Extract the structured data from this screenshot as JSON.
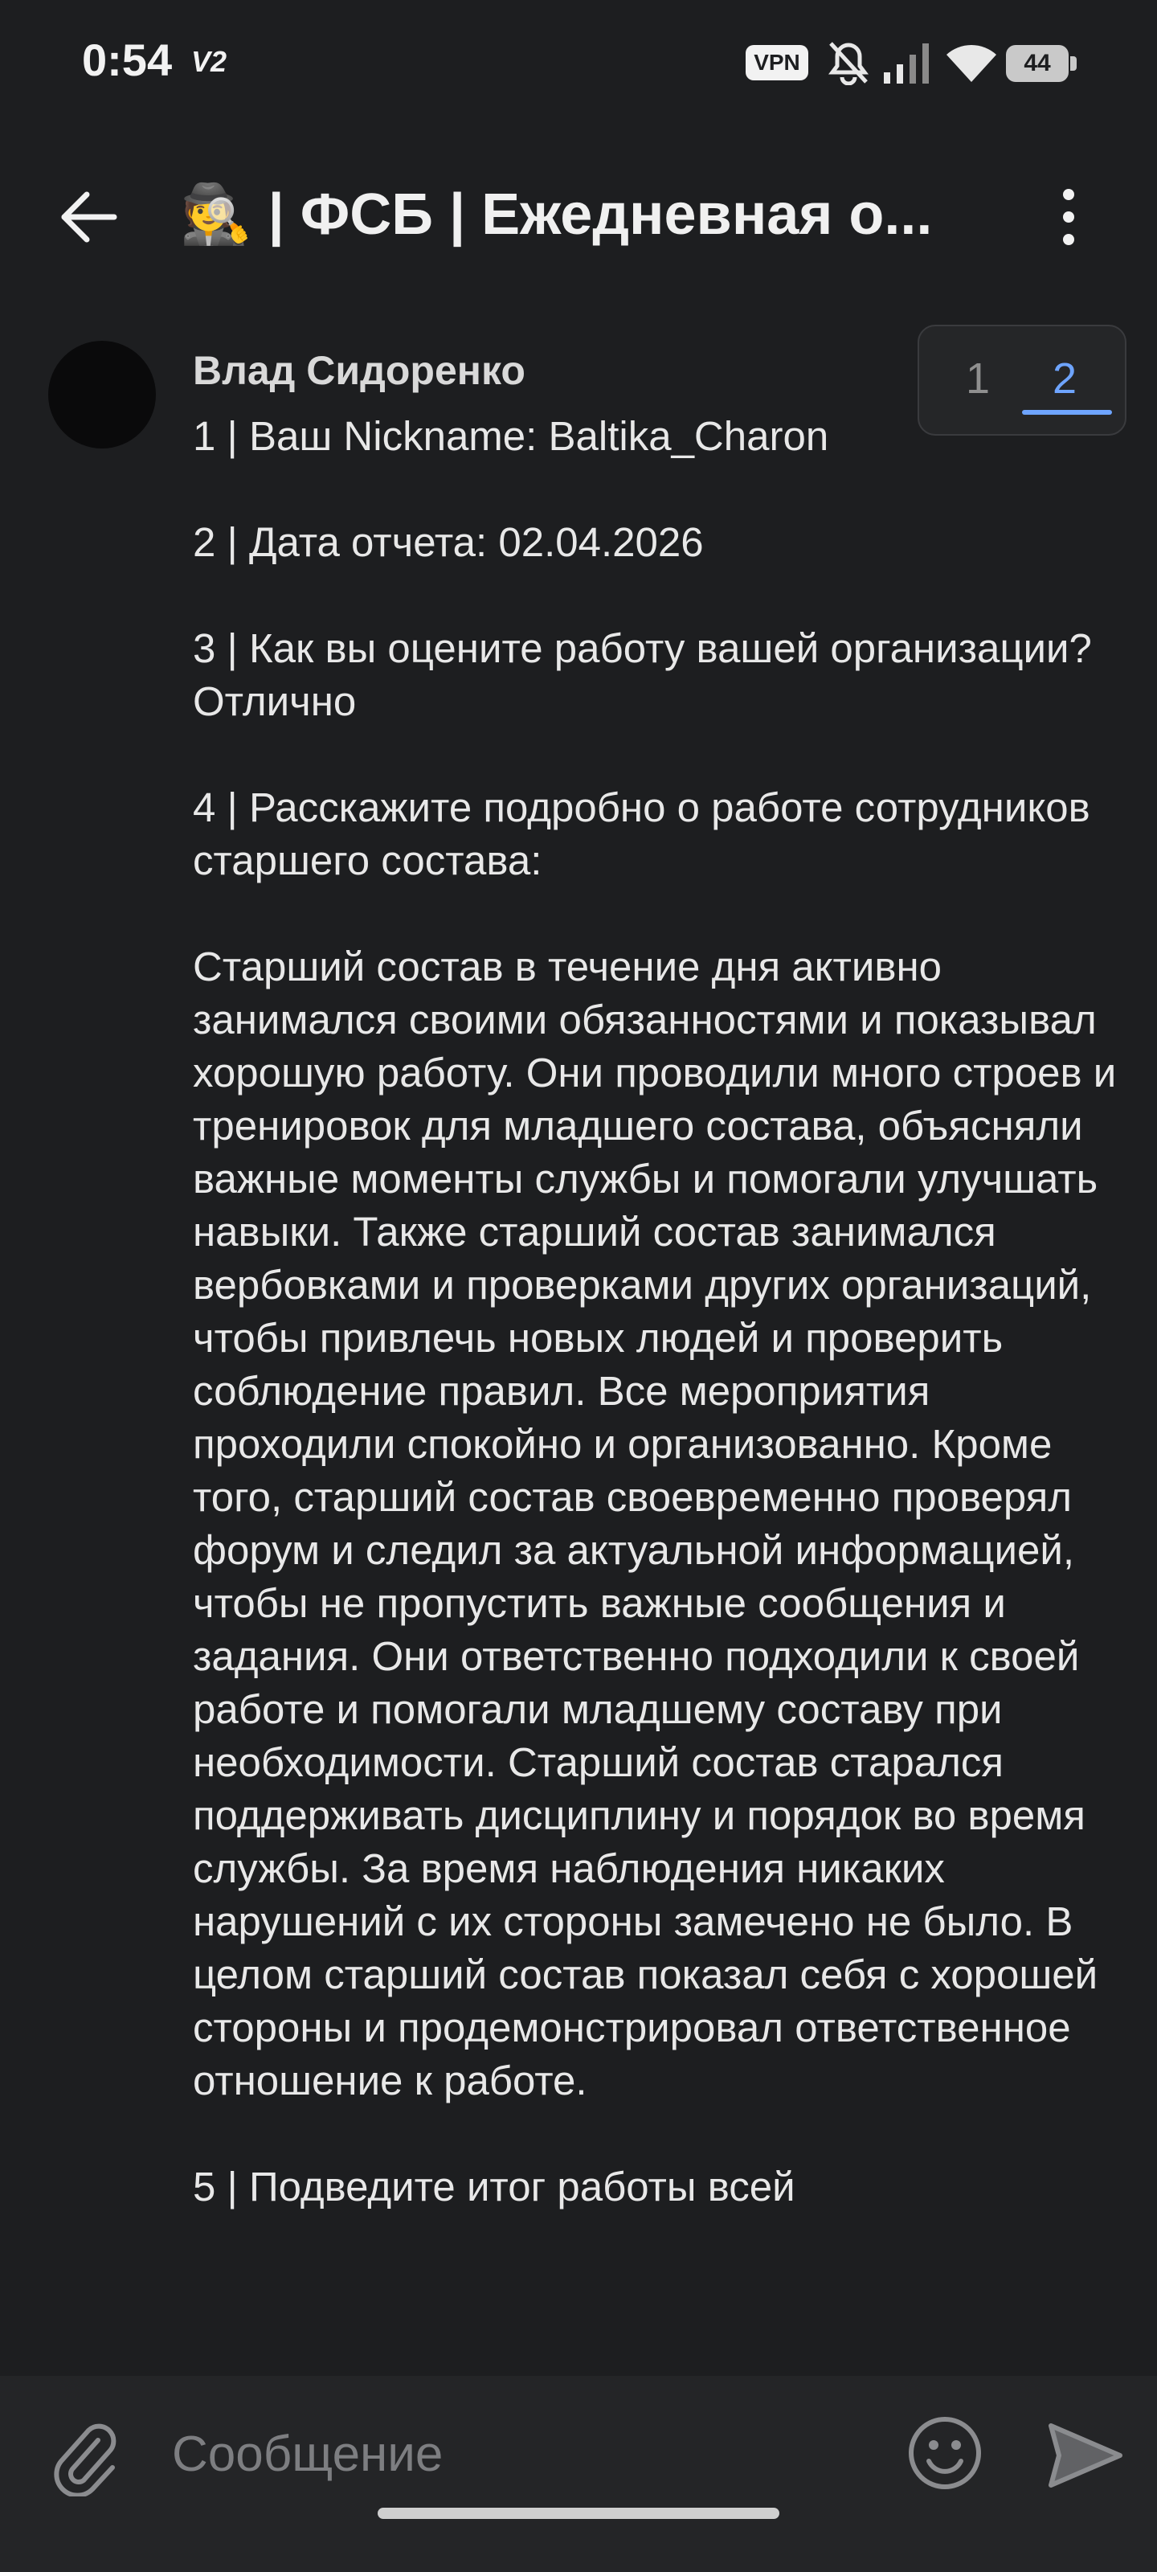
{
  "status_bar": {
    "time": "0:54",
    "network_label": "V2",
    "vpn_label": "VPN",
    "battery": "44",
    "icons": [
      "mute-icon",
      "signal-icon",
      "wifi-icon"
    ]
  },
  "header": {
    "title": "🕵️ | ФСБ | Ежедневная о...",
    "back_icon": "arrow-left-icon",
    "menu_icon": "more-vert-icon"
  },
  "message": {
    "author": "Влад Сидоренко",
    "paragraphs": [
      "1 | Ваш Nickname: Baltika_Charon",
      "2 | Дата отчета: 02.04.2026",
      "3 | Как вы оцените работу вашей организации? Отлично",
      "4 | Расскажите подробно о работе сотрудников старшего состава:",
      "Старший состав в течение дня активно занимался своими обязанностями и показывал хорошую работу. Они проводили много строев и тренировок для младшего состава, объясняли важные моменты службы и помогали улучшать навыки. Также старший состав занимался вербовками и проверками других организаций, чтобы привлечь новых людей и проверить соблюдение правил. Все мероприятия проходили спокойно и организованно. Кроме того, старший состав своевременно проверял форум и следил за актуальной информацией, чтобы не пропустить важные сообщения и задания. Они ответственно подходили к своей работе и помогали младшему составу при необходимости. Старший состав старался поддерживать дисциплину и порядок во время службы. За время наблюдения никаких нарушений с их стороны замечено не было. В целом старший состав показал себя с хорошей стороны и продемонстрировал ответственное отношение к работе.",
      "5 | Подведите итог работы всей"
    ]
  },
  "pager": {
    "page1": "1",
    "page2": "2",
    "active": 2,
    "active_color": "#6ea4ff"
  },
  "composer": {
    "placeholder": "Сообщение",
    "attach_icon": "paperclip-icon",
    "emoji_icon": "smile-icon",
    "send_icon": "send-icon"
  }
}
